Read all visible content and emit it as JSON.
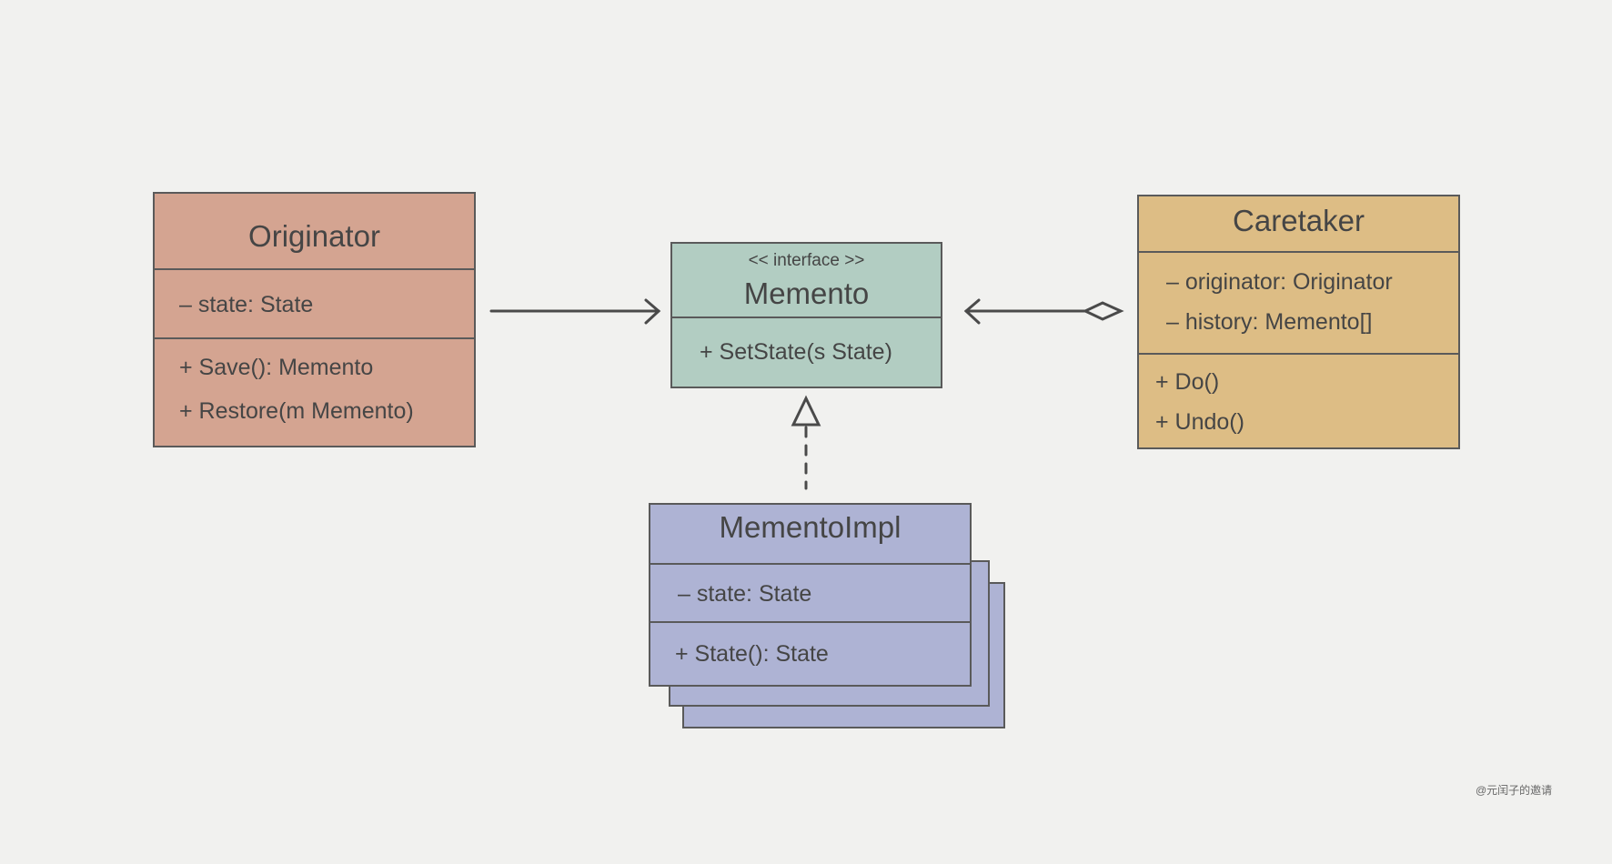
{
  "colors": {
    "originator": "#d4a491",
    "memento": "#b2cdc2",
    "caretaker": "#ddbd85",
    "memento_impl": "#aeb3d4",
    "border": "#5a5a5a",
    "background": "#f1f1ef"
  },
  "originator": {
    "name": "Originator",
    "attributes": [
      "– state: State"
    ],
    "methods": [
      "+ Save(): Memento",
      "+ Restore(m Memento)"
    ]
  },
  "memento": {
    "stereotype": "<< interface >>",
    "name": "Memento",
    "methods": [
      "+ SetState(s State)"
    ]
  },
  "caretaker": {
    "name": "Caretaker",
    "attributes": [
      "– originator: Originator",
      "– history: Memento[]"
    ],
    "methods": [
      "+ Do()",
      "+ Undo()"
    ]
  },
  "memento_impl": {
    "name": "MementoImpl",
    "attributes": [
      "– state: State"
    ],
    "methods": [
      "+ State(): State"
    ]
  },
  "relations": [
    {
      "from": "Originator",
      "to": "Memento",
      "type": "association"
    },
    {
      "from": "Caretaker",
      "to": "Memento",
      "type": "aggregation"
    },
    {
      "from": "MementoImpl",
      "to": "Memento",
      "type": "realization"
    }
  ],
  "watermark": "@元闰子的邀请"
}
